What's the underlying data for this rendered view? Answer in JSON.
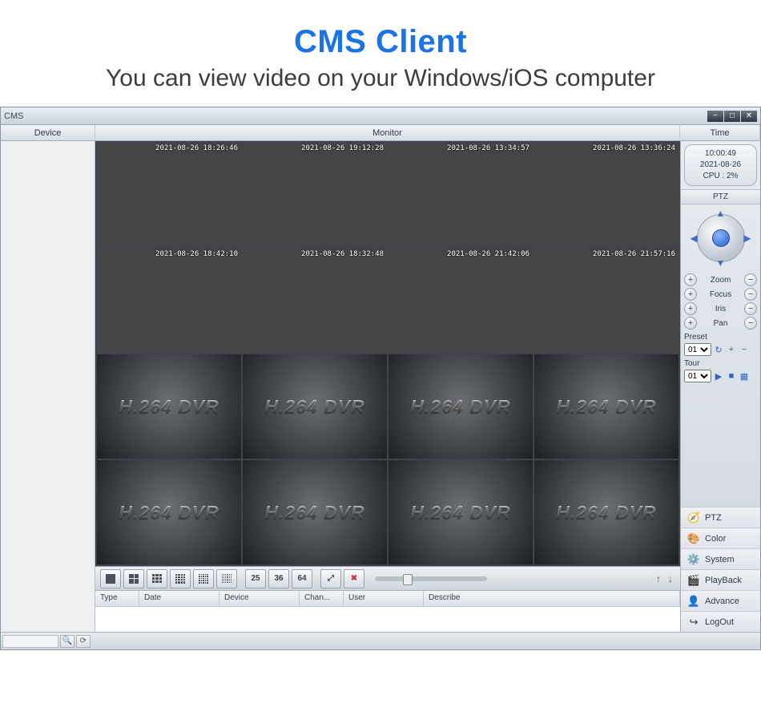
{
  "marketing": {
    "title": "CMS Client",
    "subtitle": "You can view video on your Windows/iOS computer"
  },
  "titlebar": {
    "app_name": "CMS"
  },
  "header": {
    "device": "Device",
    "monitor": "Monitor",
    "time": "Time"
  },
  "time_box": {
    "clock": "10:00:49",
    "date": "2021-08-26",
    "cpu": "CPU : 2%"
  },
  "cameras": [
    {
      "ts": "2021-08-26 18:26:46",
      "live": true
    },
    {
      "ts": "2021-08-26 19:12:28",
      "live": true
    },
    {
      "ts": "2021-08-26 13:34:57",
      "live": true
    },
    {
      "ts": "2021-08-26 13:36:24",
      "live": true
    },
    {
      "ts": "2021-08-26 18:42:10",
      "live": true
    },
    {
      "ts": "2021-08-26 18:32:48",
      "live": true
    },
    {
      "ts": "2021-08-26 21:42:06",
      "live": true
    },
    {
      "ts": "2021-08-26 21:57:16",
      "live": true
    },
    {
      "live": false
    },
    {
      "live": false
    },
    {
      "live": false
    },
    {
      "live": false
    },
    {
      "live": false
    },
    {
      "live": false
    },
    {
      "live": false
    },
    {
      "live": false
    }
  ],
  "empty_feed_label": "H.264 DVR",
  "toolbar": {
    "layout_25": "25",
    "layout_36": "36",
    "layout_64": "64"
  },
  "log_headers": {
    "type": "Type",
    "date": "Date",
    "device": "Device",
    "chan": "Chan...",
    "user": "User",
    "desc": "Describe"
  },
  "ptz": {
    "section": "PTZ",
    "zoom": "Zoom",
    "focus": "Focus",
    "iris": "Iris",
    "pan": "Pan",
    "preset": "Preset",
    "tour": "Tour",
    "preset_val": "01",
    "tour_val": "01"
  },
  "side_menu": {
    "ptz": "PTZ",
    "color": "Color",
    "system": "System",
    "playback": "PlayBack",
    "advance": "Advance",
    "logout": "LogOut"
  },
  "colors": {
    "accent": "#1a73e8"
  }
}
